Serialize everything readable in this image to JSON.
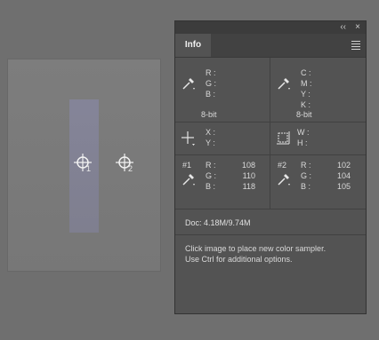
{
  "panel": {
    "tab_label": "Info",
    "collapse_label": "‹‹",
    "close_label": "×"
  },
  "readout": {
    "rgb_labels": [
      "R :",
      "G :",
      "B :"
    ],
    "cmyk_labels": [
      "C :",
      "M :",
      "Y :",
      "K :"
    ],
    "bit_depth_left": "8-bit",
    "bit_depth_right": "8-bit",
    "xy_labels": [
      "X :",
      "Y :"
    ],
    "wh_labels": [
      "W :",
      "H :"
    ]
  },
  "samplers": [
    {
      "id": "#1",
      "labels": [
        "R :",
        "G :",
        "B :"
      ],
      "values": [
        "108",
        "110",
        "118"
      ],
      "marker": "1"
    },
    {
      "id": "#2",
      "labels": [
        "R :",
        "G :",
        "B :"
      ],
      "values": [
        "102",
        "104",
        "105"
      ],
      "marker": "2"
    }
  ],
  "doc_size": "Doc: 4.18M/9.74M",
  "hint_lines": [
    "Click image to place new color sampler.",
    "Use Ctrl for additional options."
  ],
  "colors": {
    "panel_bg": "#535353",
    "workspace_bg": "#6f6f6f",
    "stripe": "#85859a"
  }
}
